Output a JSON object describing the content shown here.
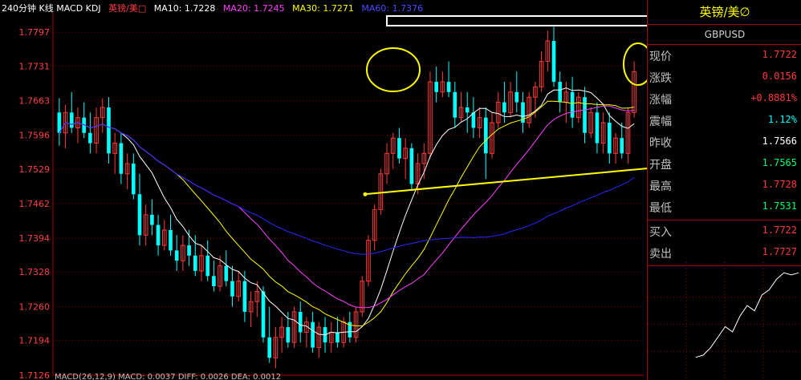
{
  "header": {
    "period": "240分钟 K线 MACD KDJ",
    "instrument": "英镑/美□",
    "ma10": "MA10: 1.7228",
    "ma20": "MA20: 1.7245",
    "ma30": "MA30: 1.7271",
    "ma60": "MA60: 1.7376",
    "macd_footer": "MACD(26,12,9) MACD: 0.0037 DIFF: 0.0026 DEA: 0.0012"
  },
  "colors": {
    "up": "#ff3a3a",
    "down": "#00ffff",
    "ma10": "#ffffff",
    "ma20": "#ffff00",
    "ma30": "#ff40ff",
    "ma60": "#2828ff",
    "grid": "#8b0000",
    "axis": "#b00000",
    "annotation": "#ffff00"
  },
  "sidebar": {
    "title": "英镑/美∅",
    "symbol": "GBPUSD",
    "quotes": [
      {
        "label": "现价",
        "value": "1.7722",
        "color": "#ff3a3a"
      },
      {
        "label": "涨跌",
        "value": "0.0156",
        "color": "#ff3a3a"
      },
      {
        "label": "涨幅",
        "value": "+0.8881%",
        "color": "#ff3a3a"
      },
      {
        "label": "震幅",
        "value": "1.12%",
        "color": "#00ffff"
      },
      {
        "label": "昨收",
        "value": "1.7566",
        "color": "#ffffff"
      },
      {
        "label": "开盘",
        "value": "1.7565",
        "color": "#00ff66"
      },
      {
        "label": "最高",
        "value": "1.7728",
        "color": "#ff3a3a"
      },
      {
        "label": "最低",
        "value": "1.7531",
        "color": "#00ff66"
      },
      {
        "label": "买入",
        "value": "1.7722",
        "color": "#ff3a3a"
      },
      {
        "label": "卖出",
        "value": "1.7727",
        "color": "#ff3a3a"
      }
    ]
  },
  "chart_data": {
    "type": "candlestick",
    "ylim": [
      1.7126,
      1.7835
    ],
    "yticks": [
      1.7797,
      1.7731,
      1.7663,
      1.7596,
      1.7529,
      1.7462,
      1.7394,
      1.7328,
      1.726,
      1.7194,
      1.7126
    ],
    "candles": [
      [
        1.764,
        1.7668,
        1.7575,
        1.76
      ],
      [
        1.76,
        1.7655,
        1.757,
        1.764
      ],
      [
        1.764,
        1.768,
        1.76,
        1.761
      ],
      [
        1.761,
        1.765,
        1.758,
        1.763
      ],
      [
        1.763,
        1.766,
        1.759,
        1.76
      ],
      [
        1.76,
        1.764,
        1.756,
        1.758
      ],
      [
        1.758,
        1.765,
        1.756,
        1.763
      ],
      [
        1.763,
        1.7668,
        1.76,
        1.765
      ],
      [
        1.765,
        1.767,
        1.754,
        1.756
      ],
      [
        1.756,
        1.76,
        1.752,
        1.758
      ],
      [
        1.758,
        1.76,
        1.75,
        1.752
      ],
      [
        1.752,
        1.756,
        1.749,
        1.754
      ],
      [
        1.754,
        1.756,
        1.747,
        1.748
      ],
      [
        1.748,
        1.752,
        1.738,
        1.74
      ],
      [
        1.74,
        1.746,
        1.738,
        1.744
      ],
      [
        1.744,
        1.747,
        1.74,
        1.742
      ],
      [
        1.742,
        1.744,
        1.736,
        1.738
      ],
      [
        1.738,
        1.743,
        1.737,
        1.741
      ],
      [
        1.741,
        1.744,
        1.736,
        1.737
      ],
      [
        1.737,
        1.74,
        1.733,
        1.735
      ],
      [
        1.735,
        1.74,
        1.733,
        1.738
      ],
      [
        1.738,
        1.741,
        1.734,
        1.736
      ],
      [
        1.736,
        1.74,
        1.732,
        1.733
      ],
      [
        1.733,
        1.738,
        1.731,
        1.736
      ],
      [
        1.736,
        1.739,
        1.731,
        1.732
      ],
      [
        1.732,
        1.735,
        1.729,
        1.73
      ],
      [
        1.73,
        1.736,
        1.729,
        1.734
      ],
      [
        1.734,
        1.737,
        1.73,
        1.731
      ],
      [
        1.731,
        1.734,
        1.726,
        1.728
      ],
      [
        1.728,
        1.733,
        1.727,
        1.731
      ],
      [
        1.731,
        1.733,
        1.723,
        1.725
      ],
      [
        1.725,
        1.729,
        1.722,
        1.727
      ],
      [
        1.727,
        1.731,
        1.724,
        1.729
      ],
      [
        1.729,
        1.73,
        1.719,
        1.72
      ],
      [
        1.72,
        1.726,
        1.715,
        1.716
      ],
      [
        1.716,
        1.722,
        1.714,
        1.72
      ],
      [
        1.72,
        1.724,
        1.717,
        1.722
      ],
      [
        1.722,
        1.725,
        1.718,
        1.719
      ],
      [
        1.719,
        1.726,
        1.718,
        1.725
      ],
      [
        1.725,
        1.727,
        1.719,
        1.721
      ],
      [
        1.721,
        1.724,
        1.718,
        1.723
      ],
      [
        1.723,
        1.725,
        1.717,
        1.718
      ],
      [
        1.718,
        1.723,
        1.716,
        1.722
      ],
      [
        1.722,
        1.724,
        1.717,
        1.719
      ],
      [
        1.719,
        1.723,
        1.717,
        1.721
      ],
      [
        1.721,
        1.724,
        1.718,
        1.719
      ],
      [
        1.719,
        1.724,
        1.718,
        1.723
      ],
      [
        1.723,
        1.725,
        1.719,
        1.72
      ],
      [
        1.72,
        1.726,
        1.719,
        1.725
      ],
      [
        1.725,
        1.732,
        1.724,
        1.731
      ],
      [
        1.731,
        1.74,
        1.73,
        1.739
      ],
      [
        1.739,
        1.746,
        1.737,
        1.745
      ],
      [
        1.745,
        1.753,
        1.744,
        1.752
      ],
      [
        1.752,
        1.758,
        1.75,
        1.756
      ],
      [
        1.756,
        1.76,
        1.753,
        1.759
      ],
      [
        1.759,
        1.761,
        1.754,
        1.755
      ],
      [
        1.755,
        1.759,
        1.751,
        1.757
      ],
      [
        1.757,
        1.758,
        1.749,
        1.75
      ],
      [
        1.75,
        1.756,
        1.748,
        1.754
      ],
      [
        1.754,
        1.758,
        1.751,
        1.756
      ],
      [
        1.756,
        1.772,
        1.755,
        1.77
      ],
      [
        1.77,
        1.773,
        1.766,
        1.768
      ],
      [
        1.768,
        1.772,
        1.767,
        1.77
      ],
      [
        1.77,
        1.774,
        1.767,
        1.768
      ],
      [
        1.768,
        1.77,
        1.761,
        1.763
      ],
      [
        1.763,
        1.768,
        1.762,
        1.765
      ],
      [
        1.765,
        1.768,
        1.76,
        1.764
      ],
      [
        1.764,
        1.767,
        1.759,
        1.761
      ],
      [
        1.761,
        1.765,
        1.759,
        1.763
      ],
      [
        1.763,
        1.765,
        1.751,
        1.756
      ],
      [
        1.756,
        1.764,
        1.755,
        1.762
      ],
      [
        1.762,
        1.768,
        1.761,
        1.766
      ],
      [
        1.766,
        1.77,
        1.762,
        1.764
      ],
      [
        1.764,
        1.77,
        1.763,
        1.768
      ],
      [
        1.768,
        1.772,
        1.764,
        1.766
      ],
      [
        1.766,
        1.768,
        1.76,
        1.762
      ],
      [
        1.762,
        1.768,
        1.761,
        1.767
      ],
      [
        1.767,
        1.77,
        1.763,
        1.769
      ],
      [
        1.769,
        1.776,
        1.768,
        1.774
      ],
      [
        1.774,
        1.78,
        1.772,
        1.778
      ],
      [
        1.778,
        1.781,
        1.769,
        1.77
      ],
      [
        1.77,
        1.772,
        1.764,
        1.766
      ],
      [
        1.766,
        1.77,
        1.762,
        1.768
      ],
      [
        1.768,
        1.771,
        1.761,
        1.763
      ],
      [
        1.763,
        1.768,
        1.762,
        1.767
      ],
      [
        1.767,
        1.769,
        1.758,
        1.76
      ],
      [
        1.76,
        1.765,
        1.759,
        1.764
      ],
      [
        1.764,
        1.766,
        1.756,
        1.758
      ],
      [
        1.758,
        1.764,
        1.756,
        1.762
      ],
      [
        1.762,
        1.764,
        1.754,
        1.756
      ],
      [
        1.756,
        1.76,
        1.754,
        1.759
      ],
      [
        1.759,
        1.762,
        1.755,
        1.756
      ],
      [
        1.756,
        1.765,
        1.754,
        1.764
      ],
      [
        1.764,
        1.774,
        1.763,
        1.772
      ]
    ],
    "ma_periods": [
      10,
      20,
      30,
      60
    ],
    "ma_colors": [
      "#ffffff",
      "#ffff00",
      "#ff40ff",
      "#2828ff"
    ],
    "annotations": [
      {
        "kind": "ellipse",
        "label": "high-cluster-1"
      },
      {
        "kind": "ellipse",
        "label": "high-cluster-2"
      },
      {
        "kind": "rectangle",
        "label": "resistance-zone"
      },
      {
        "kind": "trendline",
        "label": "support-line",
        "from": [
          1.748
        ],
        "to": [
          1.7535
        ]
      }
    ],
    "intraday": [
      1.7562,
      1.7566,
      1.758,
      1.76,
      1.762,
      1.761,
      1.764,
      1.766,
      1.765,
      1.768,
      1.769,
      1.771,
      1.7722,
      1.7718,
      1.7722
    ]
  }
}
